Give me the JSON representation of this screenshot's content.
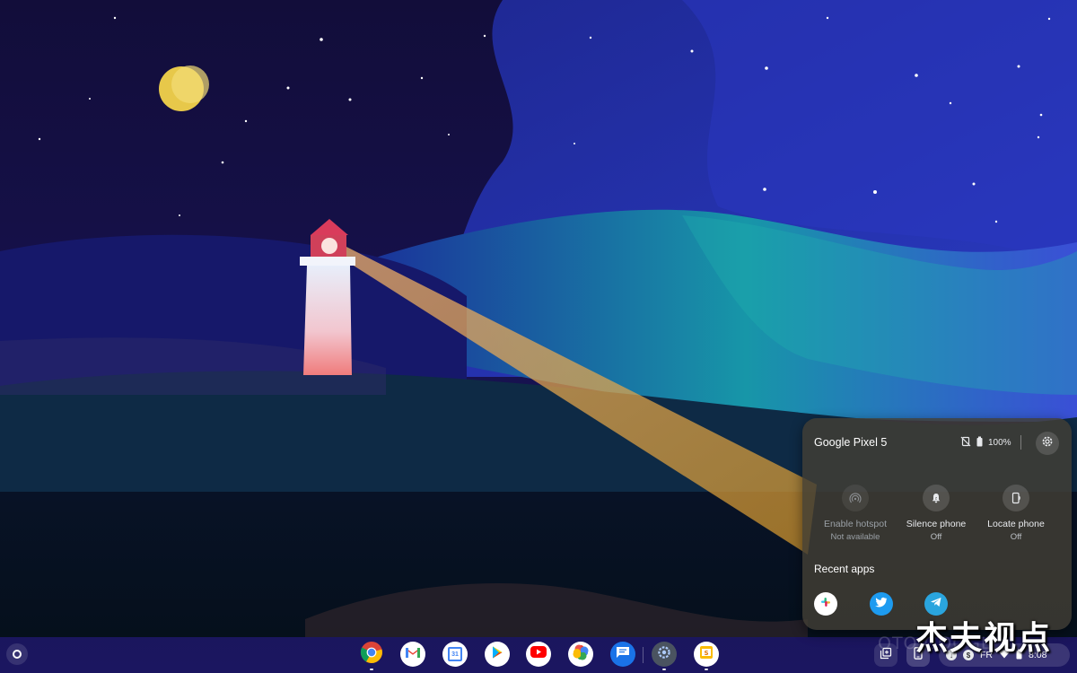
{
  "wallpaper": {
    "name": "lighthouse-night"
  },
  "phone_hub": {
    "device_name": "Google Pixel 5",
    "battery": "100%",
    "features": [
      {
        "label": "Enable hotspot",
        "status": "Not available",
        "icon": "hotspot-icon",
        "enabled": false
      },
      {
        "label": "Silence phone",
        "status": "Off",
        "icon": "bell-off-icon",
        "enabled": true
      },
      {
        "label": "Locate phone",
        "status": "Off",
        "icon": "locate-phone-icon",
        "enabled": true
      }
    ],
    "recent_apps_title": "Recent apps",
    "recent_apps": [
      "Slack",
      "Twitter",
      "Telegram"
    ]
  },
  "shelf": {
    "apps": [
      "Chrome",
      "Gmail",
      "Calendar",
      "Play Store",
      "YouTube",
      "Photos",
      "Messages",
      "Settings",
      "Slides"
    ],
    "calendar_day": "31"
  },
  "status_tray": {
    "lang": "FR",
    "time": "8:08"
  },
  "watermark": {
    "text": "OTO GOOGLE",
    "text_cn": "杰夫视点"
  },
  "colors": {
    "sky": "#140f3f",
    "panel": "#423e34",
    "teal_wave": "#1aa3a8",
    "beam": "#e8a33a"
  }
}
